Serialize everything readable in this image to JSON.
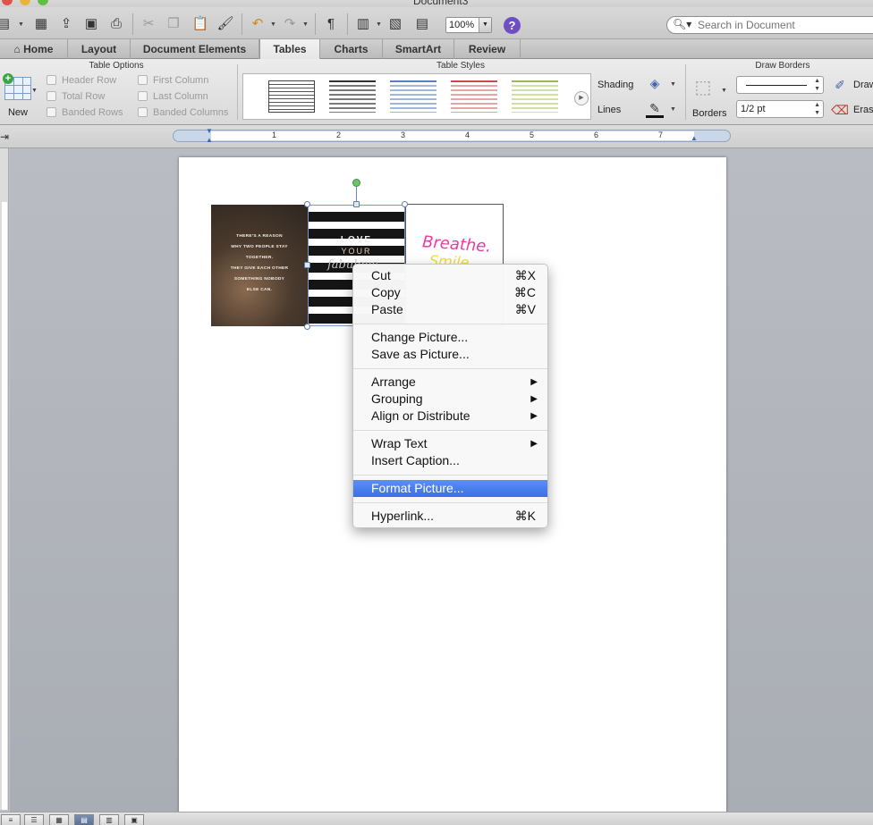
{
  "window": {
    "title": "Document3"
  },
  "toolbar": {
    "zoom": "100%",
    "search_placeholder": "Search in Document"
  },
  "ribbon_tabs": [
    "Home",
    "Layout",
    "Document Elements",
    "Tables",
    "Charts",
    "SmartArt",
    "Review"
  ],
  "active_tab": "Tables",
  "table_options": {
    "title": "Table Options",
    "new_label": "New",
    "checkboxes": [
      "Header Row",
      "Total Row",
      "Banded Rows",
      "First Column",
      "Last Column",
      "Banded Columns"
    ]
  },
  "table_styles": {
    "title": "Table Styles"
  },
  "shading_lines": {
    "shading": "Shading",
    "lines": "Lines"
  },
  "draw_borders": {
    "title": "Draw Borders",
    "borders_label": "Borders",
    "weight": "1/2 pt",
    "draw_label": "Draw",
    "erase_label": "Erase"
  },
  "ruler": {
    "numbers": [
      "1",
      "2",
      "3",
      "4",
      "5",
      "6",
      "7"
    ]
  },
  "images": {
    "quote_lines": [
      "THERE'S A REASON",
      "WHY TWO PEOPLE STAY",
      "TOGETHER.",
      "THEY GIVE EACH OTHER",
      "SOMETHING NOBODY",
      "ELSE CAN."
    ],
    "stripes_love": "LOVE",
    "stripes_your": "YOUR",
    "stripes_script": "fabulous",
    "breathe": "Breathe.",
    "smile": "Smile"
  },
  "context_menu": {
    "cut": "Cut",
    "cut_sc": "⌘X",
    "copy": "Copy",
    "copy_sc": "⌘C",
    "paste": "Paste",
    "paste_sc": "⌘V",
    "change_picture": "Change Picture...",
    "save_as_picture": "Save as Picture...",
    "arrange": "Arrange",
    "grouping": "Grouping",
    "align": "Align or Distribute",
    "wrap_text": "Wrap Text",
    "insert_caption": "Insert Caption...",
    "format_picture": "Format Picture...",
    "hyperlink": "Hyperlink...",
    "hyperlink_sc": "⌘K"
  },
  "colors": {
    "menu_highlight": "#3b6fe6",
    "help_purple": "#6e4fc2",
    "pink": "#ee3aa2",
    "yellow": "#f5de3a"
  }
}
